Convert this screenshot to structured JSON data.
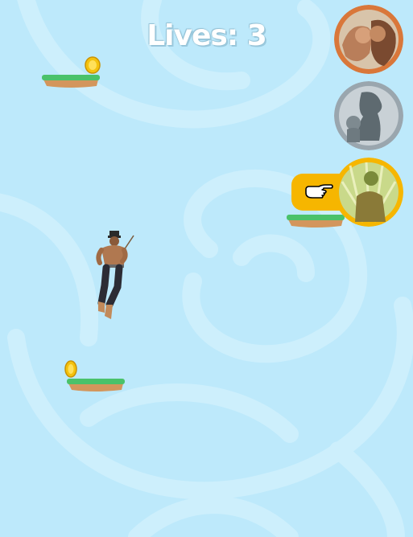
{
  "hud": {
    "lives_label": "Lives: 3",
    "lives": 3
  },
  "colors": {
    "sky": "#bde9fb",
    "swirl": "#cdeffc",
    "grass": "#4ac26a",
    "dirt": "#d3965c",
    "coin": "#f4c20d",
    "active_ring": "#f6b600",
    "level1_ring": "#d9773a",
    "locked_ring": "#9aa6ae"
  },
  "level_select": [
    {
      "name": "level-1",
      "state": "unlocked",
      "icon": "couple-portrait"
    },
    {
      "name": "level-2",
      "state": "locked",
      "icon": "mother-child-portrait"
    },
    {
      "name": "level-3",
      "state": "current",
      "icon": "glowing-figure-portrait",
      "pointer": "pointing-hand-icon"
    }
  ],
  "entities": {
    "player": "rope-climbing-man",
    "coins": 2,
    "platforms": 3
  }
}
